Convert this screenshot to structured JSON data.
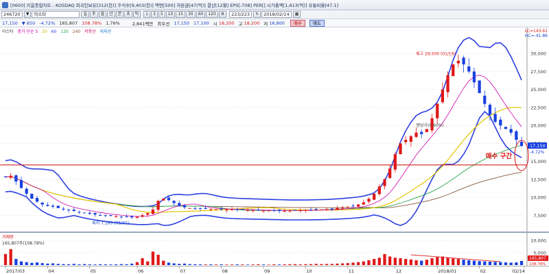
{
  "window": {
    "title_info": "[0600] 키움종합차트 - KOSDAQ 외국인보유[312(천)] 주식수[9,403(천)] 액면[500] 자본금[47(억)] 결산[12월] EPS[-708] PER[] 시가총액[1,613(억)] 유통비율[47.1]"
  },
  "toolbar": {
    "code": "246720",
    "name": "아스타",
    "period_buttons": [
      "일",
      "주",
      "월",
      "년",
      "분",
      "초",
      "틱"
    ],
    "interval_buttons": [
      "1",
      "3",
      "5",
      "10",
      "15",
      "30",
      "60",
      "120"
    ],
    "count": "223/223",
    "date": "2018/02/14"
  },
  "quote": {
    "price": "17,150",
    "change": "850",
    "change_pct": "-4.72%",
    "volume": "165,807",
    "volume_ratio": "108.78%",
    "turnover_pct": "1.76%",
    "amount": "2,841백만",
    "kind": "최우선",
    "ask": "17,150",
    "bid": "17,100",
    "open_label": "시",
    "open": "18,200",
    "high_label": "고",
    "high": "18,200",
    "low_label": "저",
    "low": "16,800",
    "buy_label": "매수",
    "sell_label": "매도"
  },
  "legend": {
    "name": "아스타",
    "price_legend": "종가 단순 5",
    "ma_items": [
      {
        "label": "20",
        "color": "#e5c400"
      },
      {
        "label": "60",
        "color": "#2b3fe0"
      },
      {
        "label": "120",
        "color": "#2ba34a"
      },
      {
        "label": "240",
        "color": "#8a5a3c"
      },
      {
        "label": "저항선",
        "color": "#c06"
      },
      {
        "label": "지지선",
        "color": "#06c"
      }
    ]
  },
  "annotations": {
    "high_label": "최고 29,500 (01/19)",
    "low_label": "최저 7,160 (05/31)",
    "mid_label": "평당가(0.60%)",
    "buy_zone": "매수 구간",
    "lc_label": "LC=143.61",
    "hc_label": "HC=-41.86",
    "current_price_tag": "17,150",
    "current_pct_tag": "-4.72%"
  },
  "chart_data": {
    "type": "candlestick",
    "title": "",
    "xlabel": "",
    "ylabel": "",
    "ylim": [
      6000,
      32500
    ],
    "yticks": [
      7500,
      10000,
      12500,
      15000,
      17500,
      20000,
      22500,
      25000,
      27500,
      30000
    ],
    "ytick_labels": [
      "7,500",
      "10,000",
      "12,500",
      "15,000",
      "17,500",
      "20,000",
      "22,500",
      "25,000",
      "27,500",
      "30,000"
    ],
    "x_labels": [
      "2017/03",
      "04",
      "05",
      "06",
      "07",
      "08",
      "09",
      "10",
      "11",
      "12",
      "2018/01",
      "02",
      "02/14"
    ],
    "support_line": 14500,
    "close_series": [
      12800,
      13000,
      12200,
      11300,
      10500,
      9800,
      9400,
      9000,
      8800,
      8700,
      8500,
      8300,
      8200,
      8100,
      7900,
      7800,
      7700,
      7600,
      7500,
      7450,
      7400,
      7350,
      7300,
      7250,
      7200,
      7300,
      7500,
      7800,
      8300,
      9500,
      9800,
      9600,
      9200,
      8800,
      8600,
      8500,
      8450,
      8400,
      8400,
      8350,
      8350,
      8300,
      8300,
      8300,
      8250,
      8250,
      8200,
      8200,
      8200,
      8150,
      8150,
      8150,
      8100,
      8100,
      8150,
      8200,
      8200,
      8250,
      8250,
      8300,
      8300,
      8350,
      8400,
      8500,
      8600,
      8700,
      8800,
      9000,
      9300,
      9800,
      10500,
      11500,
      12500,
      14000,
      16000,
      17500,
      18000,
      18500,
      19000,
      18800,
      19500,
      21000,
      23000,
      25000,
      27000,
      28500,
      29000,
      28500,
      27500,
      26000,
      24500,
      23000,
      21500,
      20500,
      20000,
      19500,
      19000,
      18000,
      17150
    ],
    "volume": {
      "ylim": [
        0,
        12000
      ],
      "yticks": [
        5000,
        10000
      ],
      "ytick_labels": [
        "5,000",
        "10,000"
      ],
      "legend": "거래량",
      "current_label": "165,807주(108.78%)",
      "current_tag": "165,807",
      "current_pct_tag": "108.78%",
      "values": [
        4500,
        6500,
        2500,
        1500,
        1200,
        900,
        1100,
        800,
        600,
        700,
        500,
        400,
        350,
        500,
        300,
        400,
        300,
        250,
        350,
        300,
        250,
        300,
        400,
        350,
        600,
        1200,
        2800,
        1500,
        5500,
        4200,
        1800,
        1000,
        700,
        500,
        600,
        400,
        350,
        300,
        250,
        300,
        250,
        300,
        200,
        250,
        300,
        250,
        200,
        250,
        300,
        250,
        200,
        300,
        250,
        300,
        350,
        400,
        300,
        350,
        400,
        500,
        400,
        450,
        500,
        600,
        700,
        800,
        1000,
        1200,
        1500,
        2000,
        2500,
        3000,
        4500,
        3500,
        3000,
        2800,
        2500,
        2300,
        2000,
        1800,
        2200,
        2800,
        3200,
        3500,
        3000,
        2700,
        2500,
        2200,
        2000,
        1800,
        1600,
        1500,
        1400,
        1300,
        1200,
        1100,
        1000,
        1100,
        1700
      ]
    }
  }
}
